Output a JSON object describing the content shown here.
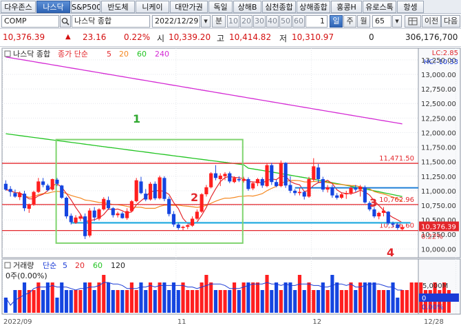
{
  "tabs": [
    {
      "label": "다우존스",
      "active": false
    },
    {
      "label": "나스닥",
      "active": true
    },
    {
      "label": "S&P500",
      "active": false
    },
    {
      "label": "반도체",
      "active": false
    },
    {
      "label": "니케이",
      "active": false
    },
    {
      "label": "대만가권",
      "active": false
    },
    {
      "label": "독일",
      "active": false
    },
    {
      "label": "상해B",
      "active": false
    },
    {
      "label": "심천종합",
      "active": false
    },
    {
      "label": "상해종합",
      "active": false
    },
    {
      "label": "홍콩H",
      "active": false
    },
    {
      "label": "유로스톡",
      "active": false
    },
    {
      "label": "항셍",
      "active": false
    }
  ],
  "controls": {
    "symbol": "COMP",
    "search_icon": "magnifier-icon",
    "name": "나스닥 종합",
    "date": "2022/12/29",
    "minute_label": "분",
    "intervals": [
      "10",
      "20",
      "30",
      "40",
      "50",
      "60"
    ],
    "count_value": "1",
    "periods": [
      {
        "label": "일",
        "selected": true
      },
      {
        "label": "주",
        "selected": false
      },
      {
        "label": "월",
        "selected": false
      }
    ],
    "bars_value": "65",
    "prev_label": "이전",
    "next_label": "다음"
  },
  "quote": {
    "price": "10,376.39",
    "change_arrow": "▲",
    "change": "23.16",
    "change_pct": "0.22%",
    "open_label": "시",
    "open": "10,339.20",
    "high_label": "고",
    "high": "10,414.82",
    "low_label": "저",
    "low": "10,310.97",
    "volume": "0",
    "amount": "306,176,700"
  },
  "price_panel": {
    "title": "나스닥 종합",
    "ma_label": "종가 단순",
    "ma_periods": [
      "5",
      "20",
      "60",
      "240"
    ],
    "lc_label": "LC:2.85",
    "hc_label": "HC:-10.33",
    "y_ticks": [
      "13,250.00",
      "13,000.00",
      "12,750.00",
      "12,500.00",
      "12,250.00",
      "12,000.00",
      "11,750.00",
      "11,500.00",
      "11,250.00",
      "11,000.00",
      "10,750.00",
      "10,500.00",
      "10,250.00",
      "10,000.00"
    ],
    "levels": [
      {
        "label": "11,471.50",
        "value": 11471.5,
        "color": "#e3262b"
      },
      {
        "label": "10,762.96",
        "value": 10762.96,
        "color": "#e3262b"
      },
      {
        "label": "10,316.60",
        "value": 10316.6,
        "color": "#e3262b"
      }
    ],
    "support_line_values": [
      11050,
      10450
    ],
    "current_price_label": "10,376.39",
    "current_pct_label": "0.22%",
    "annotations": [
      {
        "text": "1",
        "color": "#2fa82f"
      },
      {
        "text": "2",
        "color": "#e3262b"
      },
      {
        "text": "3",
        "color": "#e3262b"
      },
      {
        "text": "4",
        "color": "#e3262b"
      }
    ],
    "box_range": [
      11880,
      10100
    ],
    "colors": {
      "up": "#ff1f1f",
      "down": "#1545e0",
      "ma5": "#e3262b",
      "ma20": "#f5871f",
      "ma60": "#22c422",
      "ma240": "#d42ad4"
    }
  },
  "volume_panel": {
    "title": "거래량",
    "ma_label": "단순",
    "ma_periods": [
      "5",
      "20",
      "60",
      "120"
    ],
    "current": "0주(0.00%)",
    "y_tick": "5,000M",
    "right_value": "0",
    "right_pct": "0.00%"
  },
  "x_axis": {
    "labels": [
      {
        "text": "2022/09",
        "index": 0
      },
      {
        "text": "11",
        "index": 37
      },
      {
        "text": "12",
        "index": 66
      },
      {
        "text": "12/28",
        "index": 97
      }
    ]
  },
  "chart_data": {
    "type": "candlestick",
    "ylim": [
      9850,
      13450
    ],
    "candles": [
      [
        11120,
        11180,
        11000,
        11020
      ],
      [
        11030,
        11080,
        10900,
        10980
      ],
      [
        10960,
        11020,
        10880,
        10900
      ],
      [
        10890,
        10990,
        10840,
        10960
      ],
      [
        10950,
        11000,
        10650,
        10700
      ],
      [
        10690,
        10780,
        10620,
        10760
      ],
      [
        10760,
        11000,
        10740,
        10980
      ],
      [
        10980,
        11220,
        10960,
        11160
      ],
      [
        11160,
        11220,
        11060,
        11100
      ],
      [
        11090,
        11120,
        10990,
        11010
      ],
      [
        11020,
        11210,
        11000,
        11200
      ],
      [
        11190,
        11220,
        11080,
        11120
      ],
      [
        11090,
        11100,
        10860,
        10880
      ],
      [
        10880,
        10900,
        10520,
        10560
      ],
      [
        10570,
        10610,
        10420,
        10460
      ],
      [
        10450,
        10580,
        10430,
        10540
      ],
      [
        10520,
        10590,
        10480,
        10560
      ],
      [
        10560,
        10610,
        10170,
        10220
      ],
      [
        10230,
        10700,
        10200,
        10660
      ],
      [
        10660,
        10720,
        10480,
        10540
      ],
      [
        10520,
        10700,
        10490,
        10680
      ],
      [
        10680,
        10890,
        10660,
        10860
      ],
      [
        10840,
        10900,
        10670,
        10700
      ],
      [
        10700,
        10720,
        10540,
        10580
      ],
      [
        10580,
        10640,
        10540,
        10610
      ],
      [
        10610,
        10640,
        10520,
        10530
      ],
      [
        10530,
        10700,
        10500,
        10650
      ],
      [
        10650,
        10840,
        10630,
        10820
      ],
      [
        10820,
        11220,
        10800,
        11180
      ],
      [
        11160,
        11240,
        10940,
        10960
      ],
      [
        10950,
        11030,
        10820,
        10850
      ],
      [
        10850,
        11150,
        10830,
        11120
      ],
      [
        11120,
        11160,
        10840,
        10870
      ],
      [
        10870,
        11260,
        10850,
        11230
      ],
      [
        11220,
        11250,
        10820,
        10860
      ],
      [
        10860,
        10900,
        10560,
        10600
      ],
      [
        10600,
        10650,
        10380,
        10420
      ],
      [
        10420,
        10450,
        10330,
        10360
      ],
      [
        10360,
        10400,
        10320,
        10380
      ],
      [
        10380,
        10420,
        10340,
        10410
      ],
      [
        10400,
        10560,
        10380,
        10520
      ],
      [
        10520,
        10680,
        10500,
        10640
      ],
      [
        10640,
        10960,
        10620,
        10940
      ],
      [
        10940,
        11100,
        10900,
        11060
      ],
      [
        11060,
        11320,
        11040,
        11300
      ],
      [
        11300,
        11440,
        11180,
        11220
      ],
      [
        11200,
        11300,
        11080,
        11260
      ],
      [
        11250,
        11320,
        11180,
        11290
      ],
      [
        11300,
        11330,
        11130,
        11160
      ],
      [
        11150,
        11250,
        11130,
        11220
      ],
      [
        11200,
        11250,
        11150,
        11180
      ],
      [
        11170,
        11240,
        11140,
        11200
      ],
      [
        11200,
        11230,
        11000,
        11030
      ],
      [
        11040,
        11160,
        11010,
        11130
      ],
      [
        11130,
        11220,
        11080,
        11200
      ],
      [
        11200,
        11230,
        11050,
        11090
      ],
      [
        11080,
        11470,
        11060,
        11440
      ],
      [
        11440,
        11480,
        11100,
        11150
      ],
      [
        11150,
        11190,
        11060,
        11080
      ],
      [
        11080,
        11520,
        11060,
        11480
      ],
      [
        11480,
        11490,
        11050,
        11090
      ],
      [
        11100,
        11250,
        10960,
        11000
      ],
      [
        11000,
        11030,
        10920,
        10960
      ],
      [
        10960,
        11050,
        10920,
        10980
      ],
      [
        10980,
        11000,
        10850,
        10900
      ],
      [
        10900,
        11240,
        10880,
        11200
      ],
      [
        11190,
        11560,
        11160,
        11420
      ],
      [
        11400,
        11460,
        11140,
        11200
      ],
      [
        11200,
        11240,
        10980,
        11020
      ],
      [
        11020,
        11100,
        10970,
        11060
      ],
      [
        11060,
        11100,
        10880,
        10920
      ],
      [
        10920,
        10960,
        10850,
        10880
      ],
      [
        10880,
        10960,
        10860,
        10940
      ],
      [
        10940,
        11000,
        10860,
        10960
      ],
      [
        10960,
        11080,
        10930,
        11050
      ],
      [
        11040,
        11100,
        10980,
        11020
      ],
      [
        11020,
        11100,
        10900,
        11070
      ],
      [
        11060,
        11090,
        10780,
        10800
      ],
      [
        10790,
        10820,
        10650,
        10680
      ],
      [
        10680,
        10720,
        10530,
        10560
      ],
      [
        10560,
        10640,
        10510,
        10620
      ],
      [
        10620,
        10720,
        10560,
        10660
      ],
      [
        10640,
        10650,
        10410,
        10440
      ],
      [
        10440,
        10470,
        10380,
        10420
      ],
      [
        10420,
        10450,
        10330,
        10360
      ],
      [
        10340,
        10420,
        10310,
        10376
      ]
    ],
    "volume": [
      2,
      0,
      3,
      3,
      4,
      3,
      3,
      4,
      3,
      4,
      4,
      2,
      4,
      3,
      3,
      3,
      3,
      4,
      4,
      3,
      4,
      5,
      4,
      3,
      3,
      3,
      3,
      4,
      3,
      4,
      3,
      4,
      3,
      4,
      4,
      3,
      4,
      3,
      4,
      3,
      3,
      3,
      4,
      5,
      4,
      3,
      3,
      3,
      3,
      4,
      3,
      4,
      4,
      4,
      4,
      3,
      5,
      3,
      4,
      3,
      4,
      4,
      3,
      5,
      3,
      4,
      3,
      3,
      4,
      3,
      5,
      4,
      3,
      3,
      4,
      3,
      4,
      4,
      4,
      4,
      3,
      3,
      3,
      4,
      2,
      3,
      3,
      4,
      4,
      4,
      3,
      3,
      4,
      3,
      4,
      3
    ]
  }
}
